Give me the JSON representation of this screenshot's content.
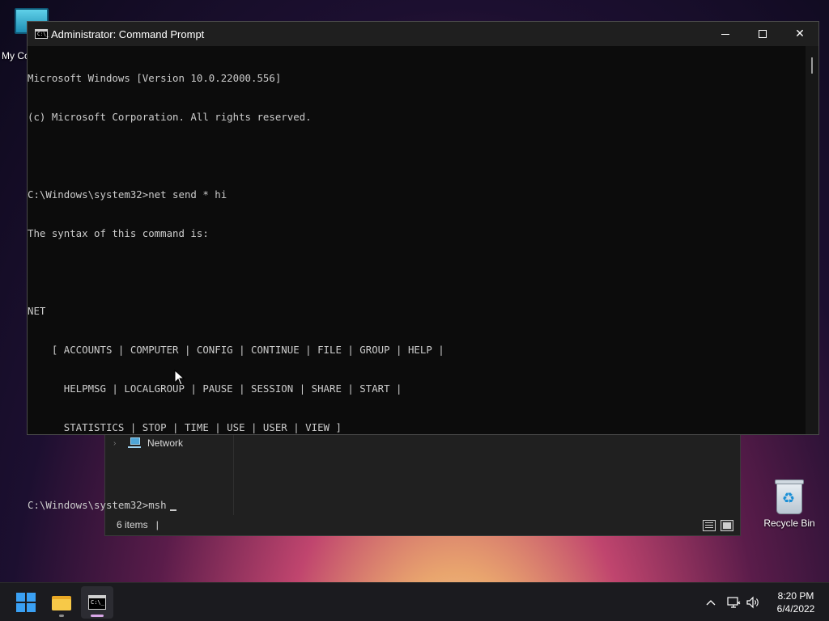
{
  "desktop": {
    "icons": [
      {
        "label": "My Computer"
      },
      {
        "label": "Recycle Bin"
      }
    ]
  },
  "explorer": {
    "nav_item": "Network",
    "status_items": "6 items",
    "status_sep": "|"
  },
  "cmd": {
    "title": "Administrator: Command Prompt",
    "icon_text": "C:\\_",
    "lines": [
      "Microsoft Windows [Version 10.0.22000.556]",
      "(c) Microsoft Corporation. All rights reserved.",
      "",
      "C:\\Windows\\system32>net send * hi",
      "The syntax of this command is:",
      "",
      "NET",
      "    [ ACCOUNTS | COMPUTER | CONFIG | CONTINUE | FILE | GROUP | HELP |",
      "      HELPMSG | LOCALGROUP | PAUSE | SESSION | SHARE | START |",
      "      STATISTICS | STOP | TIME | USE | USER | VIEW ]",
      ""
    ],
    "current_prompt": "C:\\Windows\\system32>msh"
  },
  "taskbar": {
    "apps": [
      {
        "name": "Start",
        "icon": "windows-logo-icon"
      },
      {
        "name": "File Explorer",
        "icon": "folder-icon"
      },
      {
        "name": "Command Prompt",
        "icon": "cmd-icon"
      }
    ],
    "clock": {
      "time": "8:20 PM",
      "date": "6/4/2022"
    }
  },
  "colors": {
    "accent": "#3aa0f3",
    "console_text": "#cccccc",
    "console_bg": "#0c0c0c"
  }
}
